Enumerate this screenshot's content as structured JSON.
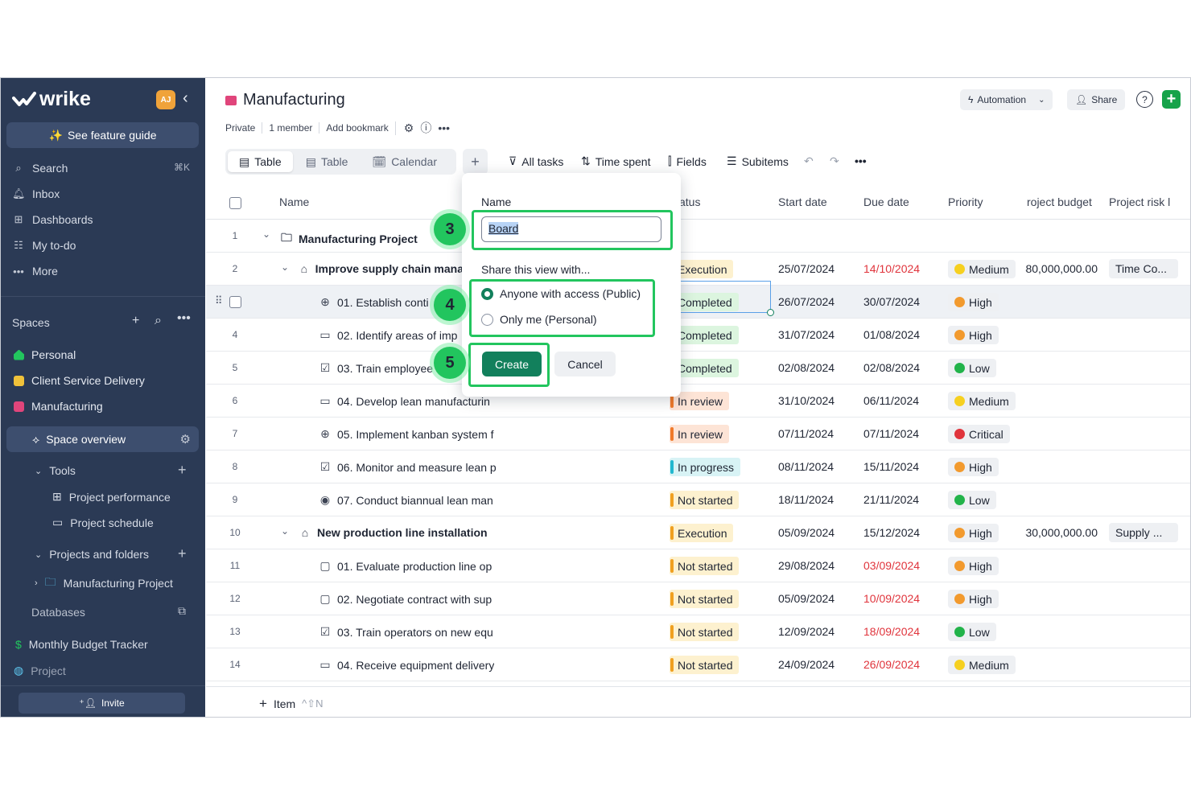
{
  "sidebar": {
    "logo": "wrike",
    "avatar": "AJ",
    "guide": "See feature guide",
    "nav": [
      {
        "label": "Search",
        "icon": "search-icon"
      },
      {
        "label": "Inbox",
        "icon": "bell-icon"
      },
      {
        "label": "Dashboards",
        "icon": "dashboard-icon"
      },
      {
        "label": "My to-do",
        "icon": "todo-icon"
      },
      {
        "label": "More",
        "icon": "more-icon"
      }
    ],
    "search_shortcut": "⌘K",
    "spaces_label": "Spaces",
    "spaces": [
      {
        "label": "Personal",
        "color": "#22c55e"
      },
      {
        "label": "Client Service Delivery",
        "color": "#f0c23a"
      },
      {
        "label": "Manufacturing",
        "color": "#e0457b"
      }
    ],
    "space_overview": "Space overview",
    "tools_label": "Tools",
    "tools": [
      "Project performance",
      "Project schedule"
    ],
    "projects_label": "Projects and folders",
    "project_item": "Manufacturing Project",
    "databases_label": "Databases",
    "bottom_items": [
      "Monthly Budget Tracker",
      "Project"
    ],
    "invite": "Invite"
  },
  "header": {
    "title": "Manufacturing",
    "meta": [
      "Private",
      "1 member",
      "Add bookmark"
    ],
    "automation": "Automation",
    "share": "Share"
  },
  "views": {
    "tabs": [
      "Table",
      "Table",
      "Calendar"
    ],
    "active": 0
  },
  "toolbar": {
    "all_tasks": "All tasks",
    "time_spent": "Time spent",
    "fields": "Fields",
    "subitems": "Subitems"
  },
  "columns": {
    "name": "Name",
    "status": "atus",
    "start": "Start date",
    "due": "Due date",
    "priority": "Priority",
    "budget": "roject budget",
    "risk": "Project risk l"
  },
  "rows": [
    {
      "num": "1",
      "name": "Manufacturing Project",
      "level": 0,
      "icon": "folder-icon",
      "bold": true,
      "status": "",
      "start": "",
      "due": "",
      "due_late": false,
      "priority": "",
      "budget": "",
      "risk": ""
    },
    {
      "num": "2",
      "name": "Improve supply chain mana",
      "level": 1,
      "icon": "project-icon",
      "bold": true,
      "status": "Execution",
      "start": "25/07/2024",
      "due": "14/10/2024",
      "due_late": true,
      "priority": "Medium",
      "budget": "$80,000,000.00",
      "risk": "Time Co..."
    },
    {
      "num": "",
      "name": "01. Establish conti",
      "level": 2,
      "icon": "milestone-icon",
      "bold": false,
      "status": "Completed",
      "start": "26/07/2024",
      "due": "30/07/2024",
      "due_late": false,
      "priority": "High",
      "budget": "",
      "risk": ""
    },
    {
      "num": "4",
      "name": "02. Identify areas of imp",
      "level": 2,
      "icon": "calendar-icon",
      "bold": false,
      "status": "Completed",
      "start": "31/07/2024",
      "due": "01/08/2024",
      "due_late": false,
      "priority": "High",
      "budget": "",
      "risk": ""
    },
    {
      "num": "5",
      "name": "03. Train employee",
      "level": 2,
      "icon": "checklist-icon",
      "bold": false,
      "status": "Completed",
      "start": "02/08/2024",
      "due": "02/08/2024",
      "due_late": false,
      "priority": "Low",
      "budget": "",
      "risk": ""
    },
    {
      "num": "6",
      "name": "04. Develop lean manufacturin",
      "level": 2,
      "icon": "calendar-icon",
      "bold": false,
      "status": "In review",
      "start": "31/10/2024",
      "due": "06/11/2024",
      "due_late": false,
      "priority": "Medium",
      "budget": "",
      "risk": ""
    },
    {
      "num": "7",
      "name": "05. Implement kanban system f",
      "level": 2,
      "icon": "milestone-icon",
      "bold": false,
      "status": "In review",
      "start": "07/11/2024",
      "due": "07/11/2024",
      "due_late": false,
      "priority": "Critical",
      "budget": "",
      "risk": ""
    },
    {
      "num": "8",
      "name": "06. Monitor and measure lean p",
      "level": 2,
      "icon": "checklist-icon",
      "bold": false,
      "status": "In progress",
      "start": "08/11/2024",
      "due": "15/11/2024",
      "due_late": false,
      "priority": "High",
      "budget": "",
      "risk": ""
    },
    {
      "num": "9",
      "name": "07. Conduct biannual lean man",
      "level": 2,
      "icon": "eye-icon",
      "bold": false,
      "status": "Not started",
      "start": "18/11/2024",
      "due": "21/11/2024",
      "due_late": false,
      "priority": "Low",
      "budget": "",
      "risk": ""
    },
    {
      "num": "10",
      "name": "New production line installation",
      "level": 1,
      "icon": "project-icon",
      "bold": true,
      "status": "Execution",
      "start": "05/09/2024",
      "due": "15/12/2024",
      "due_late": false,
      "priority": "High",
      "budget": "$30,000,000.00",
      "risk": "Supply ..."
    },
    {
      "num": "11",
      "name": "01. Evaluate production line op",
      "level": 2,
      "icon": "task-icon",
      "bold": false,
      "status": "Not started",
      "start": "29/08/2024",
      "due": "03/09/2024",
      "due_late": true,
      "priority": "High",
      "budget": "",
      "risk": ""
    },
    {
      "num": "12",
      "name": "02. Negotiate contract with sup",
      "level": 2,
      "icon": "task-icon",
      "bold": false,
      "status": "Not started",
      "start": "05/09/2024",
      "due": "10/09/2024",
      "due_late": true,
      "priority": "High",
      "budget": "",
      "risk": ""
    },
    {
      "num": "13",
      "name": "03. Train operators on new equ",
      "level": 2,
      "icon": "checklist-icon",
      "bold": false,
      "status": "Not started",
      "start": "12/09/2024",
      "due": "18/09/2024",
      "due_late": true,
      "priority": "Low",
      "budget": "",
      "risk": ""
    },
    {
      "num": "14",
      "name": "04. Receive equipment delivery",
      "level": 2,
      "icon": "calendar-icon",
      "bold": false,
      "status": "Not started",
      "start": "24/09/2024",
      "due": "26/09/2024",
      "due_late": true,
      "priority": "Medium",
      "budget": "",
      "risk": ""
    }
  ],
  "status_colors": {
    "Execution": {
      "bg": "#fdf1cf",
      "bar": "#f0a020"
    },
    "Completed": {
      "bg": "#dcf5df",
      "bar": "#22c55e"
    },
    "In review": {
      "bg": "#fde4d6",
      "bar": "#f07a2a"
    },
    "In progress": {
      "bg": "#d8f3f5",
      "bar": "#22b8cf"
    },
    "Not started": {
      "bg": "#fdf1cf",
      "bar": "#f0a020"
    }
  },
  "priority_colors": {
    "Medium": "#f6d020",
    "High": "#f29a2e",
    "Low": "#22b34a",
    "Critical": "#e0343c"
  },
  "footer": {
    "add_item": "Item",
    "shortcut": "^⇧N"
  },
  "popup": {
    "name_label": "Name",
    "name_value": "Board",
    "share_label": "Share this view with...",
    "options": [
      "Anyone with access (Public)",
      "Only me (Personal)"
    ],
    "selected": 0,
    "create": "Create",
    "cancel": "Cancel"
  },
  "annotations": {
    "steps": [
      "3",
      "4",
      "5"
    ],
    "color": "#22c55e"
  }
}
